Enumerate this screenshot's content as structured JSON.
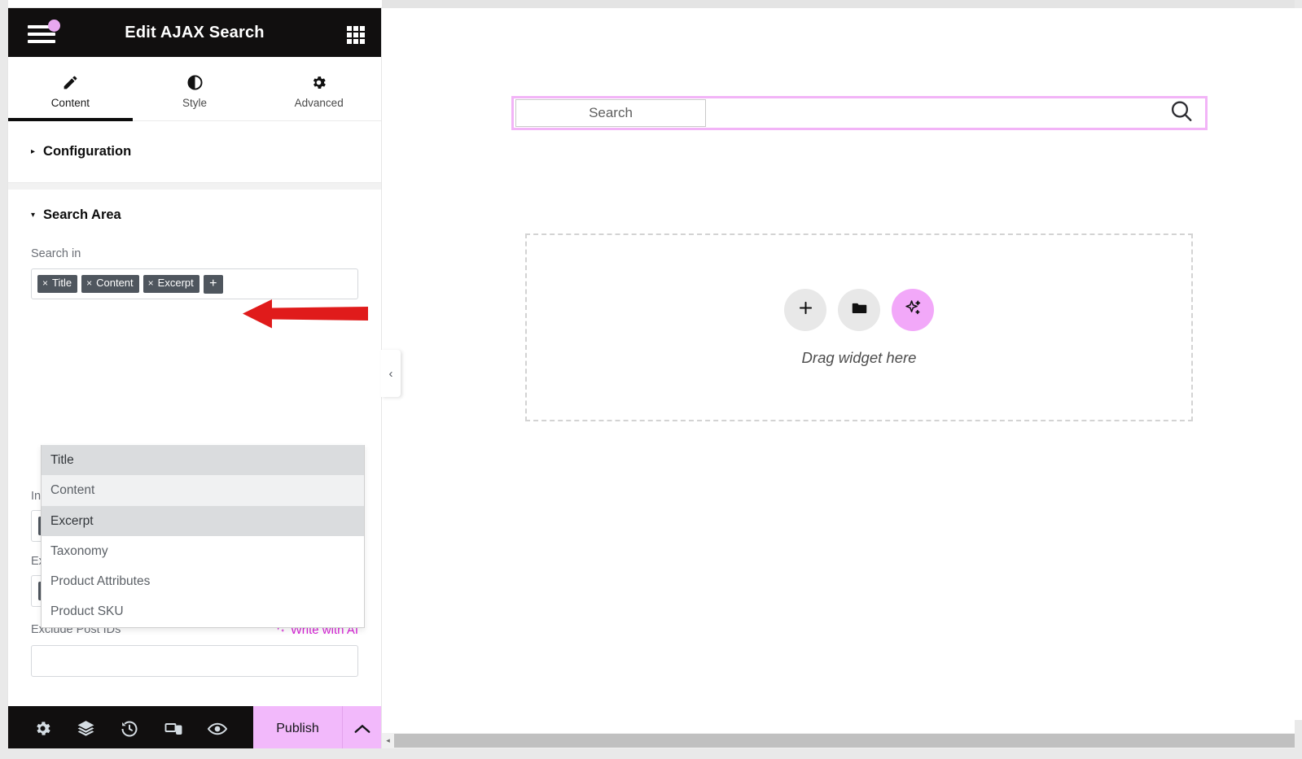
{
  "panel": {
    "title": "Edit AJAX Search",
    "menu_icon": "hamburger-menu-icon",
    "grid_icon": "apps-grid-icon",
    "tabs": [
      {
        "label": "Content",
        "icon": "pencil-icon",
        "active": true
      },
      {
        "label": "Style",
        "icon": "contrast-icon",
        "active": false
      },
      {
        "label": "Advanced",
        "icon": "gear-icon",
        "active": false
      }
    ],
    "sections": [
      {
        "label": "Configuration",
        "expanded": false,
        "caret": "▸"
      },
      {
        "label": "Search Area",
        "expanded": true,
        "caret": "▾"
      }
    ],
    "search_in": {
      "label": "Search in",
      "chips": [
        {
          "label": "Title",
          "remove": "×"
        },
        {
          "label": "Content",
          "remove": "×"
        },
        {
          "label": "Excerpt",
          "remove": "×"
        }
      ],
      "add_label": "+",
      "dropdown_options": [
        {
          "label": "Title",
          "state": "selected-dark"
        },
        {
          "label": "Content",
          "state": "selected-light"
        },
        {
          "label": "Excerpt",
          "state": "selected-dark"
        },
        {
          "label": "Taxonomy",
          "state": "normal"
        },
        {
          "label": "Product Attributes",
          "state": "normal"
        },
        {
          "label": "Product SKU",
          "state": "normal"
        }
      ]
    },
    "include_taxonomies": {
      "label": "Include Taxonomies",
      "add_label": "+"
    },
    "exclude_taxonomies": {
      "label": "Exclude Taxonomies",
      "add_label": "+"
    },
    "exclude_post_ids": {
      "label": "Exclude Post IDs",
      "ai_label": "Write with AI",
      "ai_icon": "sparkle-icon"
    },
    "footer": {
      "icons": [
        {
          "name": "settings-gear-icon"
        },
        {
          "name": "navigator-layers-icon"
        },
        {
          "name": "history-clock-icon"
        },
        {
          "name": "responsive-devices-icon"
        },
        {
          "name": "preview-eye-icon"
        }
      ],
      "publish_label": "Publish",
      "caret_icon": "chevron-up-icon"
    }
  },
  "collapse_handle": {
    "icon": "chevron-left-icon",
    "glyph": "‹"
  },
  "canvas": {
    "search_widget": {
      "placeholder": "Search",
      "search_icon": "magnifier-icon"
    },
    "drop_zone": {
      "text": "Drag widget here",
      "buttons": [
        {
          "name": "add-element-button",
          "icon": "plus-icon",
          "accent": false
        },
        {
          "name": "add-template-button",
          "icon": "folder-icon",
          "accent": false
        },
        {
          "name": "ai-generate-button",
          "icon": "sparkle-icon",
          "accent": true
        }
      ]
    }
  },
  "annotation": {
    "arrow": "red-left-arrow",
    "points_to": "add-search-in-option-button"
  },
  "colors": {
    "accent_pink": "#f2b9fb",
    "ai_magenta": "#d520d5",
    "chip_gray": "#4f565e",
    "panel_dark": "#110f0f",
    "arrow_red": "#e01b1b"
  },
  "scrollbar": {
    "left_arrow": "◂"
  }
}
